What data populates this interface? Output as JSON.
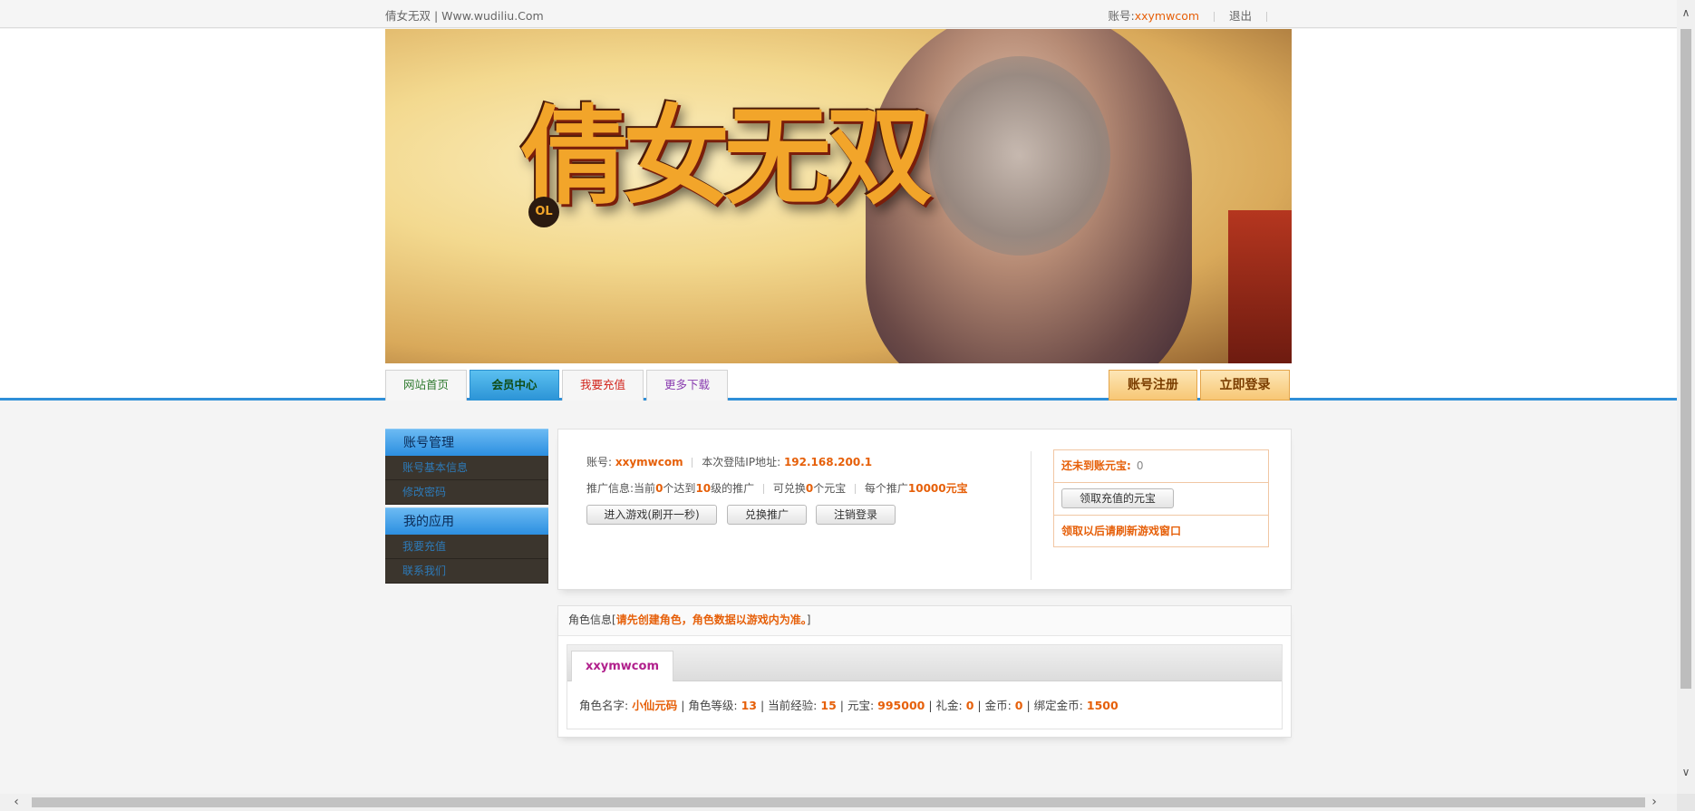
{
  "topbar": {
    "site_title": "倩女无双 | Www.wudiliu.Com",
    "account_label": "账号:",
    "account_name": "xxymwcom",
    "logout": "退出"
  },
  "banner": {
    "logo_text": "倩女无双",
    "logo_badge": "OL"
  },
  "nav": {
    "tabs": [
      {
        "label": "网站首页",
        "color": "#2f7a2f"
      },
      {
        "label": "会员中心",
        "color": "#0f4b14",
        "active": true
      },
      {
        "label": "我要充值",
        "color": "#d2261e"
      },
      {
        "label": "更多下载",
        "color": "#8a3db0"
      }
    ],
    "register": "账号注册",
    "login": "立即登录"
  },
  "sidebar": {
    "sections": [
      {
        "title": "账号管理",
        "items": [
          "账号基本信息",
          "修改密码"
        ]
      },
      {
        "title": "我的应用",
        "items": [
          "我要充值",
          "联系我们"
        ]
      }
    ]
  },
  "account_panel": {
    "account_label": "账号:",
    "account_name": "xxymwcom",
    "ip_label": "本次登陆IP地址:",
    "ip_value": "192.168.200.1",
    "promo_label": "推广信息:",
    "promo_pre": "当前",
    "promo_count": "0",
    "promo_mid1": "个达到",
    "promo_level": "10",
    "promo_mid2": "级的推广",
    "exchange_pre": "可兑换",
    "exchange_count": "0",
    "exchange_post": "个元宝",
    "reward_pre": "每个推广",
    "reward_value": "10000元宝",
    "buttons": [
      "进入游戏(刷开一秒)",
      "兑换推广",
      "注销登录"
    ]
  },
  "yuanbao_box": {
    "pending_label": "还未到账元宝:",
    "pending_value": "0",
    "claim_button": "领取充值的元宝",
    "notice": "领取以后请刷新游戏窗口"
  },
  "role_panel": {
    "header_pre": "角色信息[",
    "header_warning": "请先创建角色，角色数据以游戏内为准。",
    "header_post": "]",
    "tab": "xxymwcom",
    "name_label": "角色名字:",
    "name_value": "小仙元码",
    "level_label": "角色等级:",
    "level_value": "13",
    "exp_label": "当前经验:",
    "exp_value": "15",
    "yb_label": "元宝:",
    "yb_value": "995000",
    "gift_label": "礼金:",
    "gift_value": "0",
    "gold_label": "金币:",
    "gold_value": "0",
    "bgold_label": "绑定金币:",
    "bgold_value": "1500"
  },
  "colors": {
    "accent": "#e6600a",
    "nav_line": "#2f8fd8"
  }
}
